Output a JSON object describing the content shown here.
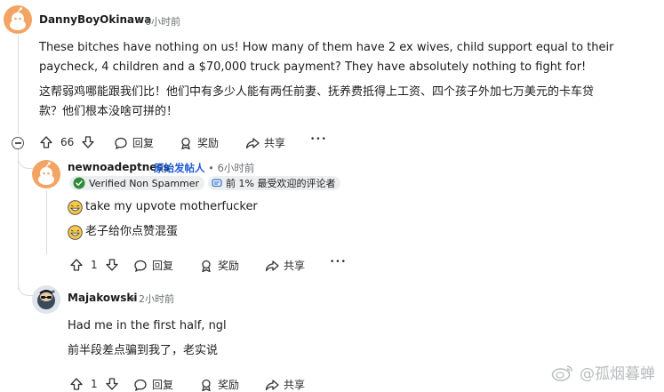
{
  "comments": [
    {
      "username": "DannyBoyOkinawa",
      "separator": "•",
      "time": "6小时前",
      "text_en": "These bitches have nothing on us! How many of them have 2 ex wives, child support equal to their paycheck, 4 children and a $70,000 truck payment? They have absolutely nothing to fight for!",
      "text_zh": "这帮弱鸡哪能跟我们比！他们中有多少人能有两任前妻、抚养费抵得上工资、四个孩子外加七万美元的卡车贷款？他们根本没啥可拼的！",
      "votes": "66",
      "reply_label": "回复",
      "award_label": "奖励",
      "share_label": "共享",
      "more": "•••"
    },
    {
      "username": "newnoadeptness",
      "op_label": "原始发帖人",
      "separator": "•",
      "time": "6小时前",
      "badge_verified": "Verified Non Spammer",
      "badge_top": "前 1% 最受欢迎的评论者",
      "text_en": "take my upvote motherfucker",
      "text_zh": "老子给你点赞混蛋",
      "votes": "1",
      "reply_label": "回复",
      "award_label": "奖励",
      "share_label": "共享",
      "more": "•••"
    },
    {
      "username": "Majakowski",
      "separator": "•",
      "time": "2小时前",
      "text_en": "Had me in the first half, ngl",
      "text_zh": "前半段差点骗到我了，老实说",
      "votes": "1",
      "reply_label": "回复",
      "award_label": "奖励",
      "share_label": "共享"
    }
  ],
  "watermark": "@孤烟暮蝉",
  "colors": {
    "op_blue": "#1c5bd6",
    "meta_gray": "#6b6f72",
    "avatar_orange": "#f3a462",
    "verified_green": "#2e8b3a"
  },
  "icons": [
    "upvote-icon",
    "downvote-icon",
    "reply-icon",
    "award-icon",
    "share-icon",
    "more-icon",
    "collapse-icon",
    "emoji-grin-icon",
    "verified-check-icon",
    "top-commenter-icon",
    "weibo-logo-icon"
  ]
}
